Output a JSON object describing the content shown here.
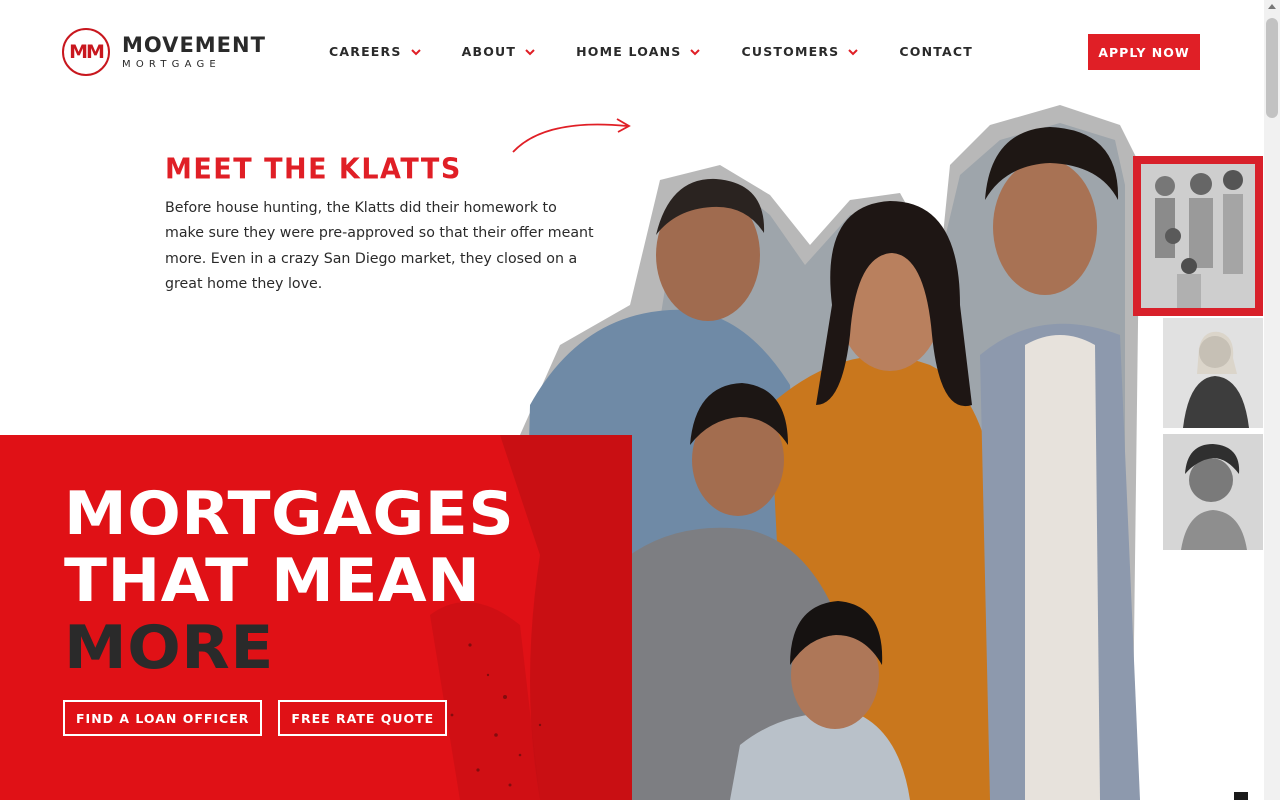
{
  "brand": {
    "logo_mark": "MM",
    "name": "MOVEMENT",
    "sub": "MORTGAGE",
    "color_primary": "#e01f26",
    "color_dark": "#2a2a2a"
  },
  "nav": {
    "items": [
      {
        "label": "CAREERS",
        "has_dropdown": true
      },
      {
        "label": "ABOUT",
        "has_dropdown": true
      },
      {
        "label": "HOME LOANS",
        "has_dropdown": true
      },
      {
        "label": "CUSTOMERS",
        "has_dropdown": true
      },
      {
        "label": "CONTACT",
        "has_dropdown": false
      }
    ],
    "cta_label": "APPLY NOW"
  },
  "story": {
    "title": "MEET THE KLATTS",
    "body": "Before house hunting, the Klatts did their homework to make sure they were pre-approved so that their offer meant more. Even in a crazy San Diego market, they closed on a great home they love."
  },
  "hero": {
    "line1": "MORTGAGES",
    "line2": "THAT MEAN",
    "line3": "MORE",
    "buttons": {
      "find_loan_officer": "FIND A LOAN OFFICER",
      "free_rate_quote": "FREE RATE QUOTE"
    }
  },
  "icons": {
    "nav_dropdown": "chevron-down-icon",
    "decorative_arrow": "curved-arrow-icon"
  }
}
